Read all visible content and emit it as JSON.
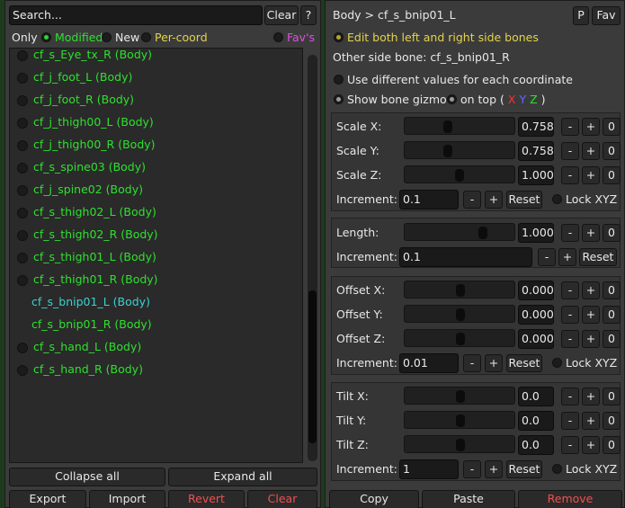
{
  "left": {
    "search_placeholder": "Search...",
    "clear_label": "Clear",
    "help_label": "?",
    "filters": {
      "only": "Only",
      "modified": "Modified",
      "new": "New",
      "per_coord": "Per-coord",
      "fav": "Fav's"
    },
    "bones": [
      {
        "name": "cf_s_Eye_tx_R (Body)",
        "dot": true
      },
      {
        "name": "cf_j_foot_L (Body)",
        "dot": true
      },
      {
        "name": "cf_j_foot_R (Body)",
        "dot": true
      },
      {
        "name": "cf_j_thigh00_L (Body)",
        "dot": true
      },
      {
        "name": "cf_j_thigh00_R (Body)",
        "dot": true
      },
      {
        "name": "cf_s_spine03 (Body)",
        "dot": true
      },
      {
        "name": "cf_j_spine02 (Body)",
        "dot": true
      },
      {
        "name": "cf_s_thigh02_L (Body)",
        "dot": true
      },
      {
        "name": "cf_s_thigh02_R (Body)",
        "dot": true
      },
      {
        "name": "cf_s_thigh01_L (Body)",
        "dot": true
      },
      {
        "name": "cf_s_thigh01_R (Body)",
        "dot": true
      },
      {
        "name": "cf_s_bnip01_L (Body)",
        "dot": false,
        "selected": true
      },
      {
        "name": "cf_s_bnip01_R (Body)",
        "dot": false
      },
      {
        "name": "cf_s_hand_L (Body)",
        "dot": true
      },
      {
        "name": "cf_s_hand_R (Body)",
        "dot": true
      }
    ],
    "collapse_all": "Collapse all",
    "expand_all": "Expand all",
    "export": "Export",
    "import": "Import",
    "revert": "Revert",
    "clear_all": "Clear"
  },
  "right": {
    "header": "Body > cf_s_bnip01_L",
    "p_label": "P",
    "fav_label": "Fav",
    "edit_both": "Edit both left and right side bones",
    "other_side": "Other side bone: cf_s_bnip01_R",
    "use_diff": "Use different values for each coordinate",
    "show_gizmo": "Show bone gizmo",
    "on_top": "on top",
    "xyz_open": "(",
    "x": "X",
    "y": "Y",
    "z": "Z",
    "xyz_close": ")",
    "minus": "-",
    "plus": "+",
    "zero": "0",
    "reset": "Reset",
    "lock_xyz": "Lock XYZ",
    "increment": "Increment:",
    "scale": {
      "x_label": "Scale X:",
      "y_label": "Scale Y:",
      "z_label": "Scale Z:",
      "x": "0.758",
      "y": "0.758",
      "z": "1.000",
      "increment": "0.1"
    },
    "length": {
      "label": "Length:",
      "value": "1.000",
      "increment": "0.1"
    },
    "offset": {
      "x_label": "Offset X:",
      "y_label": "Offset Y:",
      "z_label": "Offset Z:",
      "x": "0.000",
      "y": "0.000",
      "z": "0.000",
      "increment": "0.01"
    },
    "tilt": {
      "x_label": "Tilt X:",
      "y_label": "Tilt Y:",
      "z_label": "Tilt Z:",
      "x": "0.0",
      "y": "0.0",
      "z": "0.0",
      "increment": "1"
    },
    "copy": "Copy",
    "paste": "Paste",
    "remove": "Remove",
    "colors": {
      "x": "#ff3030",
      "y": "#5d6cff",
      "z": "#2ee02e",
      "green": "#2ee02e",
      "selected": "#3ad2d2",
      "yellow": "#e3d34a",
      "magenta": "#e04fe0",
      "red": "#f05050"
    }
  }
}
